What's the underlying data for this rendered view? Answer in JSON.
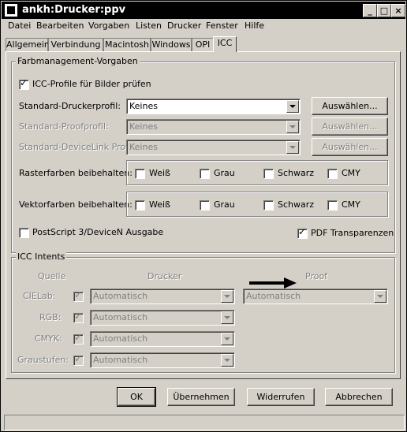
{
  "window": {
    "title": "ankh:Drucker:ppv"
  },
  "menu": [
    "Datei",
    "Bearbeiten",
    "Vorgaben",
    "Listen",
    "Drucker",
    "Fenster",
    "Hilfe"
  ],
  "tabs": [
    "Allgemein",
    "Verbindung",
    "Macintosh",
    "Windows",
    "OPI",
    "ICC"
  ],
  "active_tab": "ICC",
  "farbmanagement": {
    "title": "Farbmanagement-Vorgaben",
    "icc_profile_label": "ICC-Profile für Bilder prüfen",
    "icc_profile_checked": true,
    "drucker_label": "Standard-Druckerprofil:",
    "drucker_value": "Keines",
    "proof_label": "Standard-Proofprofil:",
    "proof_value": "Keines",
    "devicelink_label": "Standard-DeviceLink Profil:",
    "devicelink_value": "Keines",
    "select_label": "Auswählen...",
    "raster_label": "Rasterfarben beibehalten:",
    "vektor_label": "Vektorfarben beibehalten:",
    "colors": [
      "Weiß",
      "Grau",
      "Schwarz",
      "CMY"
    ],
    "postscript_label": "PostScript 3/DeviceN Ausgabe",
    "pdf_label": "PDF Transparenzen",
    "pdf_checked": true
  },
  "intents": {
    "title": "ICC Intents",
    "col_source": "Quelle",
    "col_printer": "Drucker",
    "col_proof": "Proof",
    "rows": [
      {
        "label": "CIELab:",
        "printer": "Automatisch",
        "proof": "Automatisch"
      },
      {
        "label": "RGB:",
        "printer": "Automatisch"
      },
      {
        "label": "CMYK:",
        "printer": "Automatisch"
      },
      {
        "label": "Graustufen:",
        "printer": "Automatisch"
      }
    ]
  },
  "buttons": {
    "ok": "OK",
    "apply": "Übernehmen",
    "revert": "Widerrufen",
    "cancel": "Abbrechen"
  }
}
